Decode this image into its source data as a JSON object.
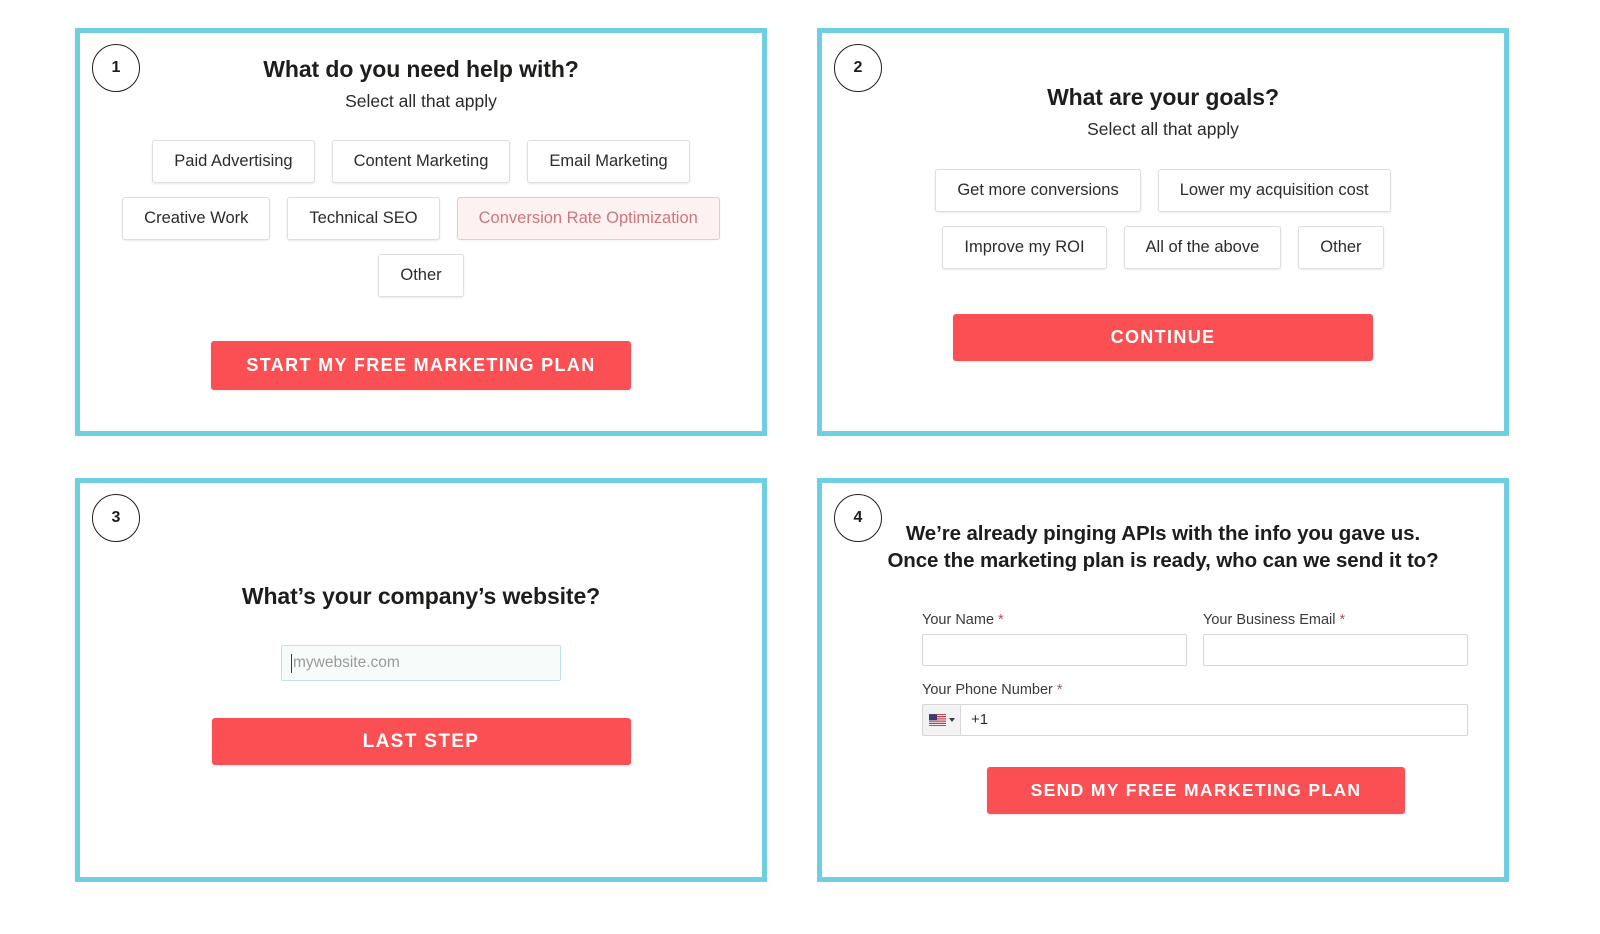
{
  "theme": {
    "panel_border_color": "#6fcee2",
    "cta_color": "#fa5053",
    "selected_chip_bg": "#fdf1f1",
    "selected_chip_border": "#f3c6c6",
    "selected_chip_text": "#cd767b",
    "required_asterisk_color": "#b4505a"
  },
  "steps": [
    {
      "number": "1",
      "title": "What do you need help with?",
      "subtitle": "Select all that apply",
      "chip_rows": [
        [
          {
            "label": "Paid Advertising",
            "selected": false
          },
          {
            "label": "Content Marketing",
            "selected": false
          },
          {
            "label": "Email Marketing",
            "selected": false
          }
        ],
        [
          {
            "label": "Creative Work",
            "selected": false
          },
          {
            "label": "Technical SEO",
            "selected": false
          },
          {
            "label": "Conversion Rate Optimization",
            "selected": true
          }
        ],
        [
          {
            "label": "Other",
            "selected": false
          }
        ]
      ],
      "cta_label": "Start My Free Marketing Plan"
    },
    {
      "number": "2",
      "title": "What are your goals?",
      "subtitle": "Select all that apply",
      "chip_rows": [
        [
          {
            "label": "Get more conversions",
            "selected": false
          },
          {
            "label": "Lower my acquisition cost",
            "selected": false
          }
        ],
        [
          {
            "label": "Improve my ROI",
            "selected": false
          },
          {
            "label": "All of the above",
            "selected": false
          },
          {
            "label": "Other",
            "selected": false
          }
        ]
      ],
      "cta_label": "Continue"
    },
    {
      "number": "3",
      "title": "What’s your company’s website?",
      "website_input": {
        "value": "",
        "placeholder": "mywebsite.com"
      },
      "cta_label": "Last Step"
    },
    {
      "number": "4",
      "title_line_1": "We’re already pinging APIs with the info you gave us.",
      "title_line_2": "Once the marketing plan is ready, who can we send it to?",
      "fields": {
        "name": {
          "label": "Your Name",
          "required_mark": "*",
          "value": "",
          "placeholder": ""
        },
        "email": {
          "label": "Your Business Email",
          "required_mark": "*",
          "value": "",
          "placeholder": ""
        },
        "phone": {
          "label": "Your Phone Number",
          "required_mark": "*",
          "country_flag": "us-flag-icon",
          "value": "+1",
          "placeholder": ""
        }
      },
      "cta_label": "Send My Free Marketing Plan"
    }
  ]
}
